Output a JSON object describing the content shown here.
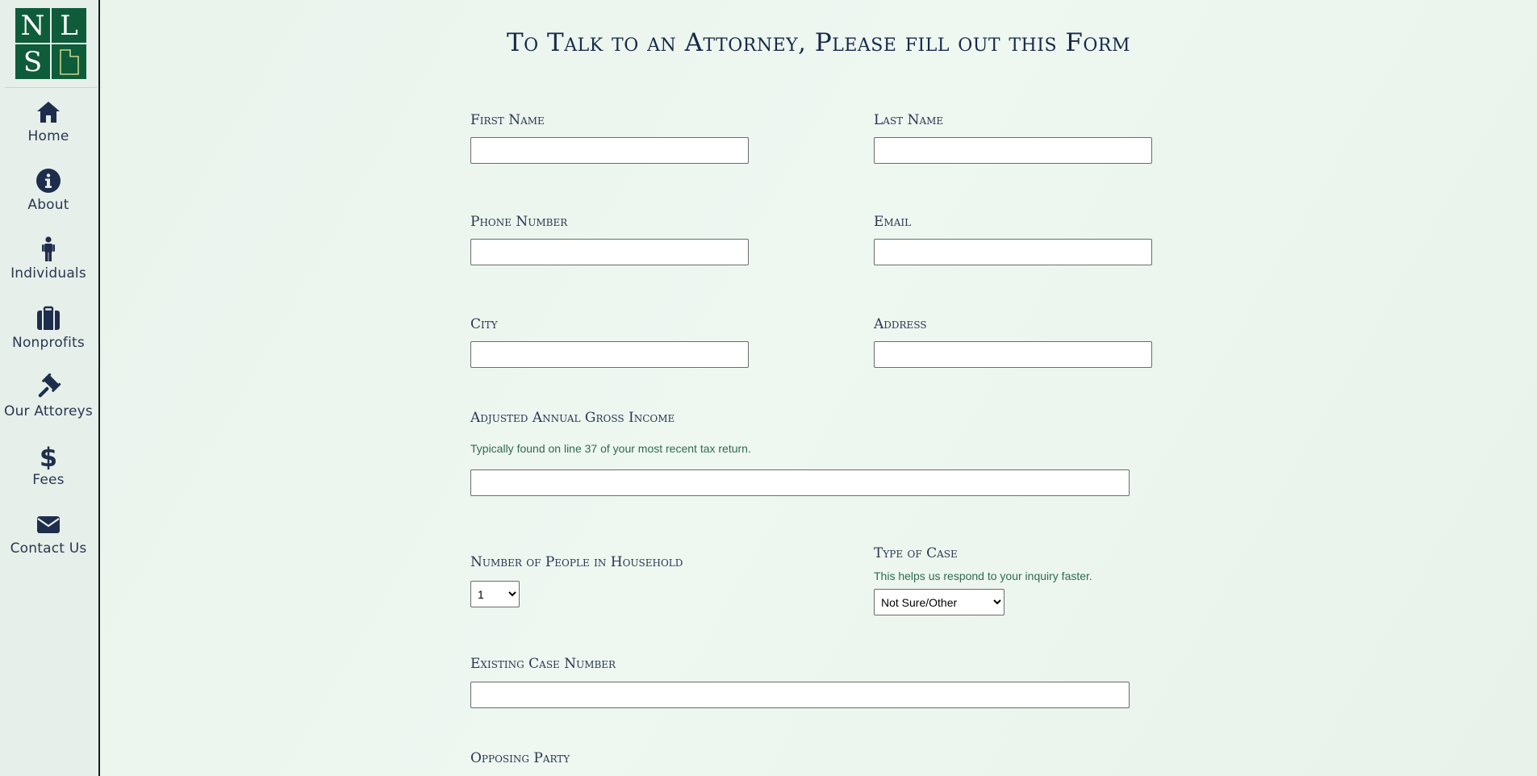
{
  "logo": {
    "letters": [
      "N",
      "L",
      "S"
    ]
  },
  "nav": [
    {
      "label": "Home",
      "icon": "home-icon"
    },
    {
      "label": "About",
      "icon": "info-icon"
    },
    {
      "label": "Individuals",
      "icon": "person-icon"
    },
    {
      "label": "Nonprofits",
      "icon": "briefcase-icon"
    },
    {
      "label": "Our Attoreys",
      "icon": "gavel-icon"
    },
    {
      "label": "Fees",
      "icon": "dollar-icon"
    },
    {
      "label": "Contact Us",
      "icon": "envelope-icon"
    }
  ],
  "form": {
    "title": "To Talk to an Attorney, Please fill out this Form",
    "first_name": {
      "label": "First Name",
      "value": ""
    },
    "last_name": {
      "label": "Last Name",
      "value": ""
    },
    "phone": {
      "label": "Phone Number",
      "value": ""
    },
    "email": {
      "label": "Email",
      "value": ""
    },
    "city": {
      "label": "City",
      "value": ""
    },
    "address": {
      "label": "Address",
      "value": ""
    },
    "income": {
      "label": "Adjusted Annual Gross Income",
      "help": "Typically found on line 37 of your most recent tax return.",
      "value": ""
    },
    "household": {
      "label": "Number of People in Household",
      "selected": "1"
    },
    "case_type": {
      "label": "Type of Case",
      "help": "This helps us respond to your inquiry faster.",
      "selected": "Not Sure/Other"
    },
    "case_number": {
      "label": "Existing Case Number",
      "value": ""
    },
    "opposing": {
      "label": "Opposing Party"
    }
  },
  "colors": {
    "brand_green": "#0e5c3a",
    "nav_text": "#2a3652",
    "help_text": "#2f6b52",
    "title_text": "#17294a"
  }
}
